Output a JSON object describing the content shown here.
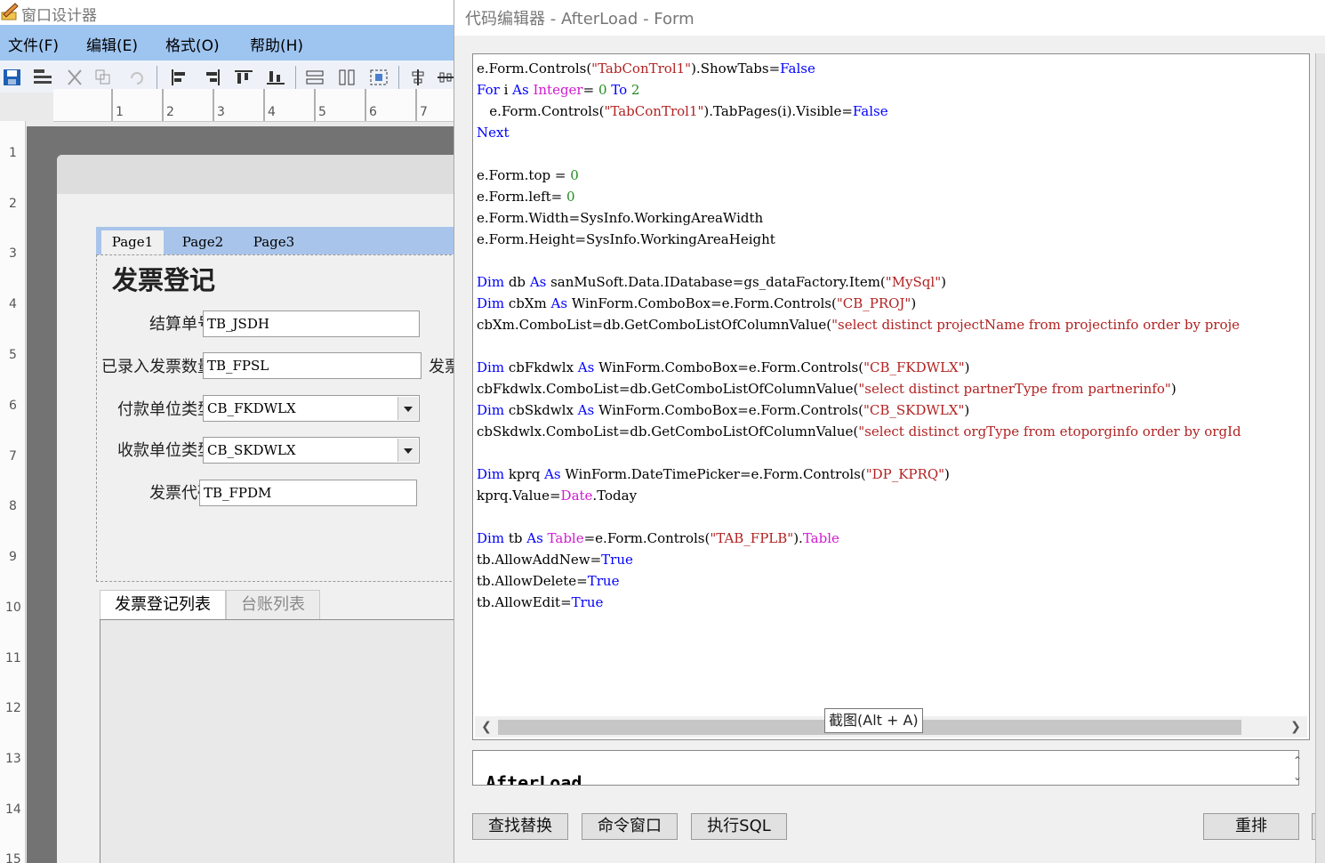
{
  "designer": {
    "title": "窗口设计器",
    "menu": [
      "文件(F)",
      "编辑(E)",
      "格式(O)",
      "帮助(H)"
    ],
    "ruler_h": [
      "1",
      "2",
      "3",
      "4",
      "5",
      "6",
      "7"
    ],
    "ruler_v": [
      "1",
      "2",
      "3",
      "4",
      "5",
      "6",
      "7",
      "8",
      "9",
      "10",
      "11",
      "12",
      "13",
      "14",
      "15"
    ],
    "form": {
      "tabs": [
        "Page1",
        "Page2",
        "Page3"
      ],
      "active_tab": "Page1",
      "heading": "发票登记",
      "fields": [
        {
          "label": "结算单号",
          "value": "TB_JSDH",
          "type": "textbox"
        },
        {
          "label": "已录入发票数量",
          "value": "TB_FPSL",
          "type": "textbox",
          "trailing": "发票"
        },
        {
          "label": "付款单位类型",
          "value": "CB_FKDWLX",
          "type": "combo"
        },
        {
          "label": "收款单位类型",
          "value": "CB_SKDWLX",
          "type": "combo"
        },
        {
          "label": "发票代码",
          "value": "TB_FPDM",
          "type": "textbox"
        }
      ],
      "bottom_tabs": [
        "发票登记列表",
        "台账列表"
      ]
    }
  },
  "editor": {
    "title": "代码编辑器 - AfterLoad - Form",
    "code_lines": [
      [
        [
          "",
          "e.Form.Controls("
        ],
        [
          "str",
          "\"TabConTrol1\""
        ],
        [
          "",
          ").ShowTabs="
        ],
        [
          "kw",
          "False"
        ]
      ],
      [
        [
          "kw",
          "For"
        ],
        [
          "",
          " i "
        ],
        [
          "kw",
          "As"
        ],
        [
          "",
          " "
        ],
        [
          "typ",
          "Integer"
        ],
        [
          "",
          "= "
        ],
        [
          "num",
          "0"
        ],
        [
          "",
          " "
        ],
        [
          "kw",
          "To"
        ],
        [
          "",
          " "
        ],
        [
          "num",
          "2"
        ]
      ],
      [
        [
          "",
          "   e.Form.Controls("
        ],
        [
          "str",
          "\"TabConTrol1\""
        ],
        [
          "",
          ").TabPages(i).Visible="
        ],
        [
          "kw",
          "False"
        ]
      ],
      [
        [
          "kw",
          "Next"
        ]
      ],
      [],
      [
        [
          "",
          "e.Form.top = "
        ],
        [
          "num",
          "0"
        ]
      ],
      [
        [
          "",
          "e.Form.left= "
        ],
        [
          "num",
          "0"
        ]
      ],
      [
        [
          "",
          "e.Form.Width=SysInfo.WorkingAreaWidth"
        ]
      ],
      [
        [
          "",
          "e.Form.Height=SysInfo.WorkingAreaHeight"
        ]
      ],
      [],
      [
        [
          "kw",
          "Dim"
        ],
        [
          "",
          " db "
        ],
        [
          "kw",
          "As"
        ],
        [
          "",
          " sanMuSoft.Data.IDatabase=gs_dataFactory.Item("
        ],
        [
          "str",
          "\"MySql\""
        ],
        [
          "",
          ")"
        ]
      ],
      [
        [
          "kw",
          "Dim"
        ],
        [
          "",
          " cbXm "
        ],
        [
          "kw",
          "As"
        ],
        [
          "",
          " WinForm.ComboBox=e.Form.Controls("
        ],
        [
          "str",
          "\"CB_PROJ\""
        ],
        [
          "",
          ")"
        ]
      ],
      [
        [
          "",
          "cbXm.ComboList=db.GetComboListOfColumnValue("
        ],
        [
          "str",
          "\"select distinct projectName from projectinfo order by proje"
        ]
      ],
      [],
      [
        [
          "kw",
          "Dim"
        ],
        [
          "",
          " cbFkdwlx "
        ],
        [
          "kw",
          "As"
        ],
        [
          "",
          " WinForm.ComboBox=e.Form.Controls("
        ],
        [
          "str",
          "\"CB_FKDWLX\""
        ],
        [
          "",
          ")"
        ]
      ],
      [
        [
          "",
          "cbFkdwlx.ComboList=db.GetComboListOfColumnValue("
        ],
        [
          "str",
          "\"select distinct partnerType from partnerinfo\""
        ],
        [
          "",
          ")"
        ]
      ],
      [
        [
          "kw",
          "Dim"
        ],
        [
          "",
          " cbSkdwlx "
        ],
        [
          "kw",
          "As"
        ],
        [
          "",
          " WinForm.ComboBox=e.Form.Controls("
        ],
        [
          "str",
          "\"CB_SKDWLX\""
        ],
        [
          "",
          ")"
        ]
      ],
      [
        [
          "",
          "cbSkdwlx.ComboList=db.GetComboListOfColumnValue("
        ],
        [
          "str",
          "\"select distinct orgType from etoporginfo order by orgId"
        ]
      ],
      [],
      [
        [
          "kw",
          "Dim"
        ],
        [
          "",
          " kprq "
        ],
        [
          "kw",
          "As"
        ],
        [
          "",
          " WinForm.DateTimePicker=e.Form.Controls("
        ],
        [
          "str",
          "\"DP_KPRQ\""
        ],
        [
          "",
          ")"
        ]
      ],
      [
        [
          "",
          "kprq.Value="
        ],
        [
          "typ",
          "Date"
        ],
        [
          "",
          ".Today"
        ]
      ],
      [],
      [
        [
          "kw",
          "Dim"
        ],
        [
          "",
          " tb "
        ],
        [
          "kw",
          "As"
        ],
        [
          "",
          " "
        ],
        [
          "typ",
          "Table"
        ],
        [
          "",
          "=e.Form.Controls("
        ],
        [
          "str",
          "\"TAB_FPLB\""
        ],
        [
          "",
          ")."
        ],
        [
          "typ",
          "Table"
        ]
      ],
      [
        [
          "",
          "tb.AllowAddNew="
        ],
        [
          "kw",
          "True"
        ]
      ],
      [
        [
          "",
          "tb.AllowDelete="
        ],
        [
          "kw",
          "True"
        ]
      ],
      [
        [
          "",
          "tb.AllowEdit="
        ],
        [
          "kw",
          "True"
        ]
      ]
    ],
    "tooltip": "截图(Alt + A)",
    "event_name": "AfterLoad",
    "buttons": {
      "find_replace": "查找替换",
      "command_window": "命令窗口",
      "run_sql": "执行SQL",
      "rearrange": "重排"
    },
    "right_stub_chars": [
      "",
      "",
      ""
    ]
  },
  "colors": {
    "keyword": "#0000ff",
    "string": "#b22222",
    "number": "#228b22",
    "type": "#d11ad1",
    "menu_bar": "#9ec4f0",
    "tab_strip": "#a8c4ea"
  }
}
